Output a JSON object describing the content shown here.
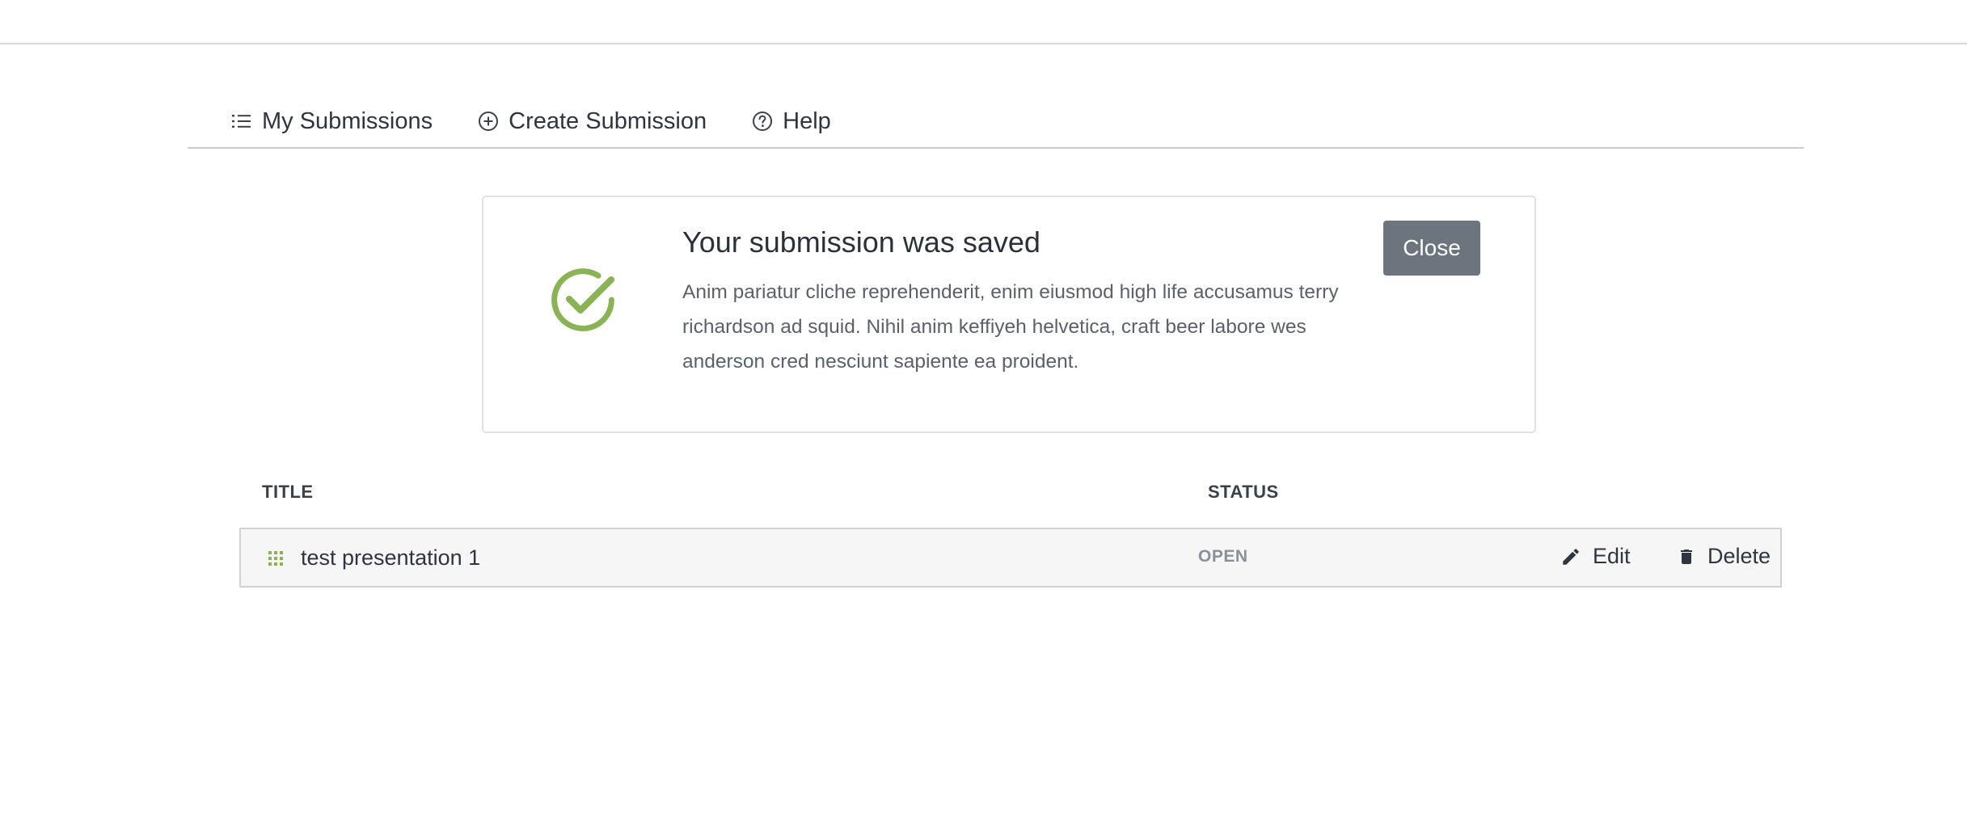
{
  "nav": {
    "items": [
      {
        "label": "My Submissions",
        "icon": "list-icon"
      },
      {
        "label": "Create Submission",
        "icon": "plus-circle-icon"
      },
      {
        "label": "Help",
        "icon": "question-circle-icon"
      }
    ]
  },
  "alert": {
    "title": "Your submission was saved",
    "body": "Anim pariatur cliche reprehenderit, enim eiusmod high life accusamus terry richardson ad squid. Nihil anim keffiyeh helvetica, craft beer labore wes anderson cred nesciunt sapiente ea proident.",
    "close_label": "Close",
    "icon": "check-circle-icon",
    "icon_color": "#8ab356"
  },
  "table": {
    "headers": {
      "title": "TITLE",
      "status": "STATUS"
    },
    "rows": [
      {
        "title": "test presentation 1",
        "status": "OPEN",
        "edit_label": "Edit",
        "delete_label": "Delete"
      }
    ]
  },
  "colors": {
    "accent_green": "#8ab356",
    "button_gray": "#6c757d"
  }
}
